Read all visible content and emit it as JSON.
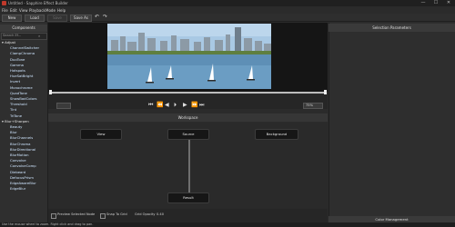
{
  "window": {
    "title": "Untitled - Sapphire Effect Builder",
    "minimize": "—",
    "maximize": "☐",
    "close": "✕"
  },
  "menu": [
    "File",
    "Edit",
    "View",
    "Playback",
    "Mode",
    "Help"
  ],
  "toolbar": {
    "new": "New",
    "load": "Load",
    "save": "Save",
    "save_as": "Save As",
    "undo": "↶",
    "redo": "↷"
  },
  "left_panel": {
    "title": "Components",
    "search_placeholder": "Search Ef...",
    "groups": [
      {
        "name": "Adjust",
        "items": [
          "ChannelSwitcher",
          "ClampChroma",
          "DuoTone",
          "Gamma",
          "Hotspots",
          "HueSatBright",
          "Invert",
          "Monochrome",
          "QuadTone",
          "ShowBadColors",
          "Threshold",
          "Tint",
          "TriTone"
        ]
      },
      {
        "name": "Blur+Sharpen",
        "items": [
          "Beauty",
          "Blur",
          "BlurChannels",
          "BlurChroma",
          "BlurDirectional",
          "BlurMotion",
          "Convolve",
          "ConvolveComp",
          "Diebeard",
          "DefocusPrism",
          "EdgeAwareBlur",
          "EdgeBlur"
        ]
      }
    ]
  },
  "playbar": {
    "zoom": "▭",
    "percent": "75%",
    "buttons": [
      "⏮",
      "⏪",
      "◀",
      "⏵",
      "▶",
      "⏩",
      "⏭"
    ]
  },
  "workspace": {
    "title": "Workspace",
    "nodes": {
      "view": "View",
      "source": "Source",
      "background": "Background",
      "result": "Result"
    }
  },
  "bottom": {
    "preview_selected": "Preview Selected Node",
    "snap_grid": "Snap To Grid",
    "grid_opacity_label": "Grid Opacity",
    "grid_opacity_value": "0.40"
  },
  "right_panel": {
    "title": "Selection Parameters",
    "color_title": "Color Management"
  },
  "status": "Use the mouse wheel to zoom. Right click and drag to pan."
}
